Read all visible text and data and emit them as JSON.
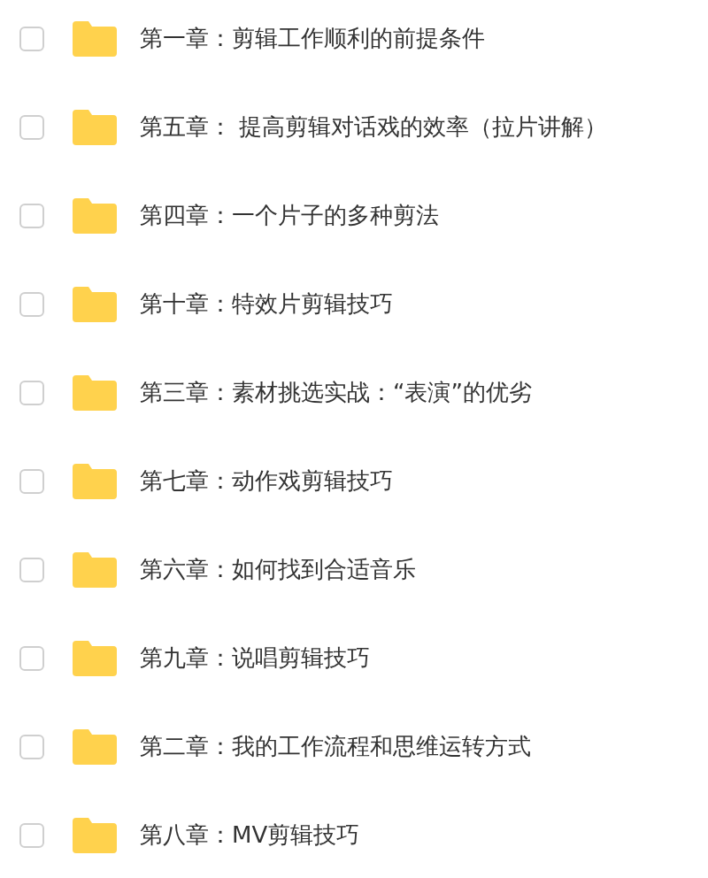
{
  "folders": [
    {
      "name": "第一章：剪辑工作顺利的前提条件",
      "checked": false
    },
    {
      "name": "第五章： 提高剪辑对话戏的效率（拉片讲解）",
      "checked": false
    },
    {
      "name": "第四章：一个片子的多种剪法",
      "checked": false
    },
    {
      "name": "第十章：特效片剪辑技巧",
      "checked": false
    },
    {
      "name": "第三章：素材挑选实战：“表演”的优劣",
      "checked": false
    },
    {
      "name": "第七章：动作戏剪辑技巧",
      "checked": false
    },
    {
      "name": "第六章：如何找到合适音乐",
      "checked": false
    },
    {
      "name": "第九章：说唱剪辑技巧",
      "checked": false
    },
    {
      "name": "第二章：我的工作流程和思维运转方式",
      "checked": false
    },
    {
      "name": "第八章：MV剪辑技巧",
      "checked": false
    }
  ]
}
